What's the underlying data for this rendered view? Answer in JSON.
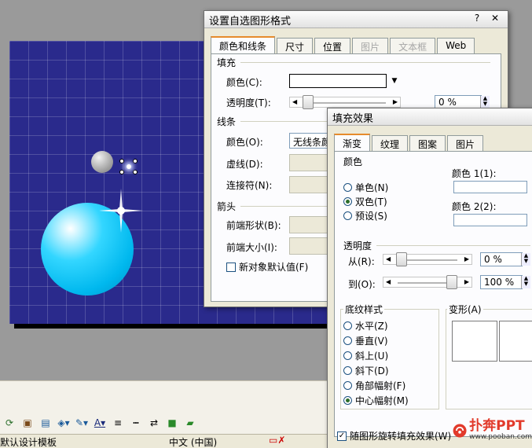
{
  "status": {
    "template": "默认设计模板",
    "language": "中文 (中国)"
  },
  "toolbar": {
    "icons": [
      "refresh-icon",
      "picture-icon",
      "image-icon",
      "fill-color-icon",
      "line-color-icon",
      "font-color-icon",
      "line-style-icon",
      "dash-style-icon",
      "arrow-style-icon",
      "shadow-icon",
      "3d-icon"
    ],
    "font_color_glyph": "A"
  },
  "format_dialog": {
    "title": "设置自选图形格式",
    "help": "?",
    "close": "✕",
    "tabs": [
      {
        "label": "颜色和线条",
        "state": "active"
      },
      {
        "label": "尺寸",
        "state": "normal"
      },
      {
        "label": "位置",
        "state": "normal"
      },
      {
        "label": "图片",
        "state": "disabled"
      },
      {
        "label": "文本框",
        "state": "disabled"
      },
      {
        "label": "Web",
        "state": "normal"
      }
    ],
    "fill_section": "填充",
    "color_label": "颜色(C):",
    "transparency_label": "透明度(T):",
    "transparency_value": "0 %",
    "transparency_level": 0.0,
    "line_section": "线条",
    "line_color_label": "颜色(O):",
    "line_color_value": "无线条颜色",
    "dash_label": "虚线(D):",
    "connector_label": "连接符(N):",
    "arrows_section": "箭头",
    "begin_style_label": "前端形状(B):",
    "begin_size_label": "前端大小(I):",
    "default_label": "新对象默认值(F)"
  },
  "fill_dialog": {
    "title": "填充效果",
    "tabs": [
      {
        "label": "渐变",
        "state": "active"
      },
      {
        "label": "纹理",
        "state": "normal"
      },
      {
        "label": "图案",
        "state": "normal"
      },
      {
        "label": "图片",
        "state": "normal"
      }
    ],
    "colors_section": "颜色",
    "color_options": [
      {
        "label": "单色(N)",
        "selected": false
      },
      {
        "label": "双色(T)",
        "selected": true
      },
      {
        "label": "预设(S)",
        "selected": false
      }
    ],
    "color1_label": "颜色 1(1):",
    "color2_label": "颜色 2(2):",
    "transparency_section": "透明度",
    "from_label": "从(R):",
    "from_value": "0 %",
    "from_level": 0.0,
    "to_label": "到(O):",
    "to_value": "100 %",
    "to_level": 1.0,
    "shading_section": "底纹样式",
    "shading_styles": [
      {
        "label": "水平(Z)",
        "selected": false
      },
      {
        "label": "垂直(V)",
        "selected": false
      },
      {
        "label": "斜上(U)",
        "selected": false
      },
      {
        "label": "斜下(D)",
        "selected": false
      },
      {
        "label": "角部幅射(F)",
        "selected": false
      },
      {
        "label": "中心幅射(M)",
        "selected": true
      }
    ],
    "variants_section": "变形(A)",
    "rotate_label": "随图形旋转填充效果(W)",
    "rotate_checked": true
  },
  "watermark": {
    "brand": "扑奔PPT",
    "url": "www.pooban.com"
  },
  "colors": {
    "slide_bg": "#2a2a8c",
    "sphere": "#00b8ee",
    "accent_tab": "#e68b2c"
  }
}
